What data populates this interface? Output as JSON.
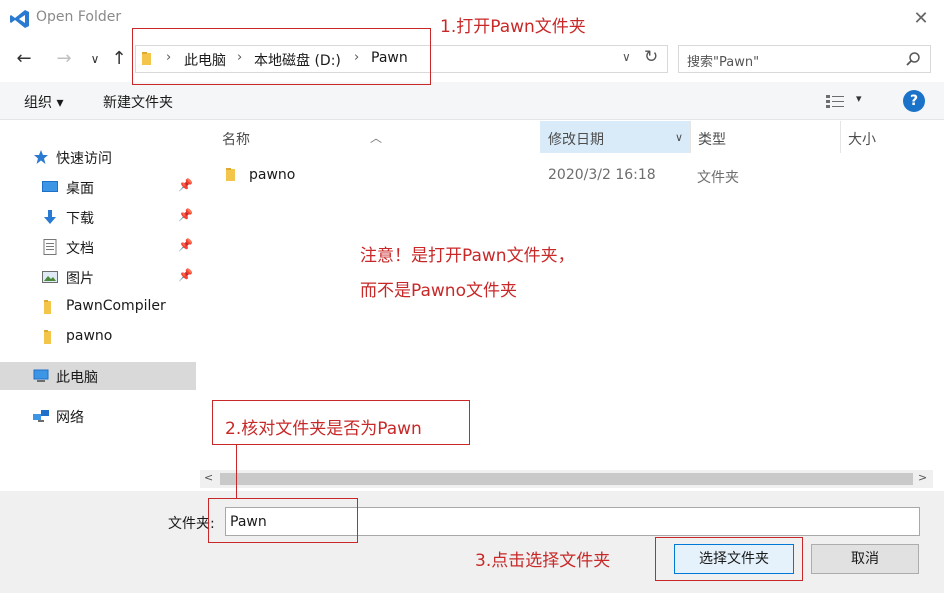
{
  "window": {
    "title": "Open Folder",
    "close_glyph": "✕"
  },
  "nav": {
    "back_glyph": "←",
    "forward_glyph": "→",
    "recent_glyph": "∨",
    "up_glyph": "↑",
    "breadcrumb": [
      "此电脑",
      "本地磁盘 (D:)",
      "Pawn"
    ],
    "crumb_sep": "›",
    "dropdown_glyph": "∨",
    "refresh_glyph": "↻",
    "search_placeholder": "搜索\"Pawn\""
  },
  "toolbar": {
    "organize_label": "组织 ▾",
    "new_folder_label": "新建文件夹",
    "view_dd_glyph": "▾",
    "help_glyph": "?"
  },
  "sidebar": {
    "items": [
      {
        "label": "快速访问",
        "icon": "star-icon"
      },
      {
        "label": "桌面",
        "icon": "desktop-icon",
        "pinned": true
      },
      {
        "label": "下载",
        "icon": "download-icon",
        "pinned": true
      },
      {
        "label": "文档",
        "icon": "document-icon",
        "pinned": true
      },
      {
        "label": "图片",
        "icon": "pictures-icon",
        "pinned": true
      },
      {
        "label": "PawnCompiler",
        "icon": "folder-icon"
      },
      {
        "label": "pawno",
        "icon": "folder-icon"
      },
      {
        "label": "此电脑",
        "icon": "computer-icon",
        "selected": true
      },
      {
        "label": "网络",
        "icon": "network-icon"
      }
    ],
    "pin_glyph": "📌"
  },
  "columns": {
    "name": "名称",
    "modified": "修改日期",
    "type": "类型",
    "size": "大小",
    "sort_glyph": "︿",
    "filter_glyph": "∨"
  },
  "rows": [
    {
      "name": "pawno",
      "modified": "2020/3/2 16:18",
      "type": "文件夹"
    }
  ],
  "scroll": {
    "left_glyph": "<",
    "right_glyph": ">"
  },
  "bottom": {
    "folder_label": "文件夹:",
    "folder_value": "Pawn",
    "select_button": "选择文件夹",
    "cancel_button": "取消"
  },
  "annotations": {
    "step1": "1.打开Pawn文件夹",
    "note_line1": "注意！是打开Pawn文件夹，",
    "note_line2": "而不是Pawno文件夹",
    "step2": "2.核对文件夹是否为Pawn",
    "step3": "3.点击选择文件夹",
    "color": "#c82828"
  },
  "colors": {
    "accent": "#0078d7",
    "vscode_blue": "#2a7ad1",
    "folder_yellow": "#f3c54a",
    "selection": "#d9d9d9"
  }
}
